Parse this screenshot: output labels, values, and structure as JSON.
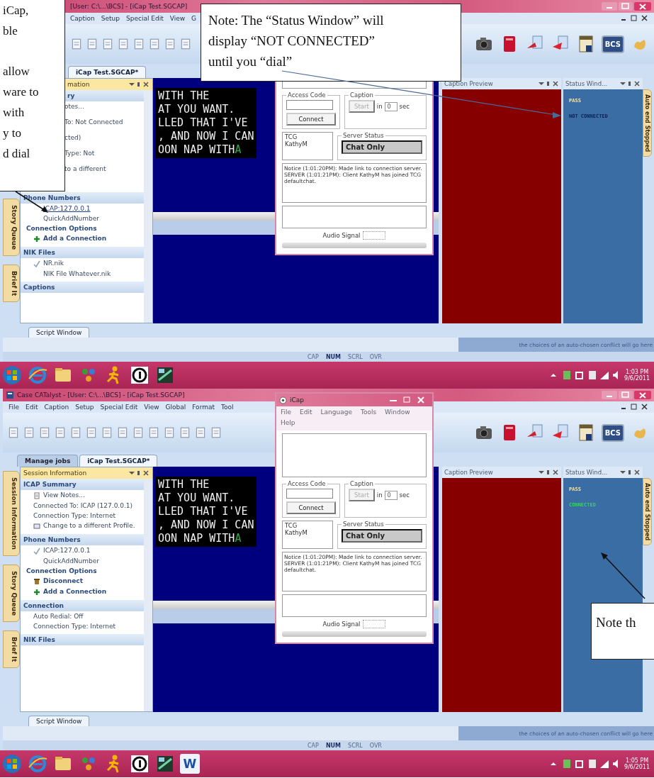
{
  "screens": [
    {
      "window": {
        "title": "[User: C:\\...\\BCS] - [iCap Test.SGCAP]"
      },
      "menu": [
        "Caption",
        "Setup",
        "Special Edit",
        "View",
        "G"
      ],
      "toolbar": {
        "label": "BCS"
      },
      "tabs": [
        {
          "label": "iCap Test.SGCAP*",
          "selected": true
        }
      ],
      "panel": {
        "title": "mation",
        "sections": [
          {
            "heading": "ry",
            "items": [
              {
                "kind": "text",
                "text": "otes..."
              },
              {
                "kind": "text",
                "text": "To: Not Connected"
              },
              {
                "kind": "text",
                "text": "cted)"
              },
              {
                "kind": "text",
                "text": "Type: Not"
              },
              {
                "kind": "text",
                "text": "to a different"
              }
            ]
          },
          {
            "heading": "Phone Numbers",
            "items": [
              {
                "kind": "link",
                "text": "ICAP:127.0.0.1"
              },
              {
                "kind": "indent",
                "text": "QuickAddNumber"
              },
              {
                "kind": "subhead",
                "text": "Connection Options"
              },
              {
                "kind": "add",
                "text": "Add a Connection"
              }
            ]
          },
          {
            "heading": "NIK Files",
            "items": [
              {
                "kind": "checked",
                "text": "NR.nik"
              },
              {
                "kind": "indent",
                "text": "NIK File Whatever.nik"
              }
            ]
          },
          {
            "heading": "Captions"
          }
        ]
      },
      "side_tabs": [
        "Story Queue",
        "Brief It"
      ],
      "editor_lines": [
        {
          "text": "WITH THE"
        },
        {
          "text": "AT YOU WANT."
        },
        {
          "text": "LLED THAT I'VE"
        },
        {
          "text": ", AND NOW I CAN"
        },
        {
          "text": "OON NAP WITH",
          "cursor": "A"
        }
      ],
      "caption_preview": {
        "title": "Caption Preview"
      },
      "status_window": {
        "title": "Status Wind...",
        "lines": [
          {
            "kind": "result",
            "text": "PASS"
          },
          {
            "kind": "connection",
            "text": "NOT CONNECTED",
            "connected": false
          }
        ]
      },
      "right_tab": "Auto end Stopped",
      "script_tab": "Script Window",
      "conflict_message": "the choices of an auto-chosen conflict will go here",
      "indicators": [
        {
          "label": "CAP",
          "on": false
        },
        {
          "label": "NUM",
          "on": true
        },
        {
          "label": "SCRL",
          "on": false
        },
        {
          "label": "OVR",
          "on": false
        }
      ],
      "dialog": {
        "access_code_label": "Access Code",
        "connect": "Connect",
        "caption_label": "Caption",
        "start": "Start",
        "start_disabled": true,
        "in": "in",
        "delay": "0",
        "sec": "sec",
        "users": [
          "TCG",
          "KathyM"
        ],
        "server_status_label": "Server Status",
        "server_status": "Chat Only",
        "log": [
          "Notice (1:01:20PM): Made link to connection server.",
          "SERVER (1:01:21PM): Client KathyM has joined TCG defaultchat."
        ],
        "audio_label": "Audio Signal"
      },
      "taskbar": {
        "apps": [
          {
            "kind": "start"
          },
          {
            "kind": "browser"
          },
          {
            "kind": "folder"
          },
          {
            "kind": "network"
          },
          {
            "kind": "runner"
          },
          {
            "kind": "info"
          },
          {
            "kind": "app"
          }
        ],
        "time": "1:03 PM",
        "date": "9/6/2011"
      },
      "callouts": [
        {
          "kind": "side",
          "lines": [
            "iCap,",
            "ble",
            "allow",
            "ware to",
            "with",
            "y to",
            "d dial"
          ]
        },
        {
          "kind": "box",
          "text": "Note: The “Status Window” will display “NOT CONNECTED” until you “dial”"
        }
      ]
    },
    {
      "window": {
        "title": "Case CATalyst - [User: C:\\...\\BCS] - [iCap Test.SGCAP]"
      },
      "menu": [
        "File",
        "Edit",
        "Caption",
        "Setup",
        "Special Edit",
        "View",
        "Global",
        "Format",
        "Tool"
      ],
      "toolbar": {
        "label": "BCS"
      },
      "tabs": [
        {
          "label": "Manage jobs",
          "selected": false
        },
        {
          "label": "iCap Test.SGCAP*",
          "selected": true
        }
      ],
      "panel": {
        "title": "Session Information",
        "sections": [
          {
            "heading": "ICAP Summary",
            "items": [
              {
                "kind": "notes",
                "text": "View Notes..."
              },
              {
                "kind": "text",
                "text": "Connected To: ICAP (127.0.0.1)"
              },
              {
                "kind": "text",
                "text": "Connection Type: Internet"
              },
              {
                "kind": "change",
                "text": "Change to a different Profile."
              }
            ]
          },
          {
            "heading": "Phone Numbers",
            "items": [
              {
                "kind": "checked",
                "text": "ICAP:127.0.0.1"
              },
              {
                "kind": "indent",
                "text": "QuickAddNumber"
              },
              {
                "kind": "subhead",
                "text": "Connection Options"
              },
              {
                "kind": "disconnect",
                "text": "Disconnect"
              },
              {
                "kind": "add",
                "text": "Add a Connection"
              }
            ]
          },
          {
            "heading": "Connection",
            "items": [
              {
                "kind": "text",
                "text": "Auto Redial: Off"
              },
              {
                "kind": "text",
                "text": "Connection Type: Internet"
              }
            ]
          },
          {
            "heading": "NIK Files"
          }
        ]
      },
      "side_tabs": [
        "Session Information",
        "Story Queue",
        "Brief It"
      ],
      "editor_lines": [
        {
          "text": "WITH THE"
        },
        {
          "text": "AT YOU WANT."
        },
        {
          "text": "LLED THAT I'VE"
        },
        {
          "text": ", AND NOW I CAN"
        },
        {
          "text": "OON NAP WITH",
          "cursor": "A"
        }
      ],
      "caption_preview": {
        "title": "Caption Preview"
      },
      "status_window": {
        "title": "Status Wind...",
        "lines": [
          {
            "kind": "result",
            "text": "PASS"
          },
          {
            "kind": "connection",
            "text": "CONNECTED",
            "connected": true
          }
        ]
      },
      "right_tab": "Auto end Stopped",
      "script_tab": "Script Window",
      "conflict_message": "the choices of an auto-chosen conflict will go here",
      "indicators": [
        {
          "label": "CAP",
          "on": false
        },
        {
          "label": "NUM",
          "on": true
        },
        {
          "label": "SCRL",
          "on": false
        },
        {
          "label": "OVR",
          "on": false
        }
      ],
      "dialog": {
        "title": "iCap",
        "menu": [
          "File",
          "Edit",
          "Language",
          "Tools",
          "Window",
          "Help"
        ],
        "access_code_label": "Access Code",
        "connect": "Connect",
        "caption_label": "Caption",
        "start": "Start",
        "start_disabled": true,
        "in": "in",
        "delay": "0",
        "sec": "sec",
        "users": [
          "TCG",
          "KathyM"
        ],
        "server_status_label": "Server Status",
        "server_status": "Chat Only",
        "log": [
          "Notice (1:01:20PM): Made link to connection server.",
          "SERVER (1:01:21PM): Client KathyM has joined TCG defaultchat."
        ],
        "audio_label": "Audio Signal"
      },
      "taskbar": {
        "apps": [
          {
            "kind": "start"
          },
          {
            "kind": "browser"
          },
          {
            "kind": "folder"
          },
          {
            "kind": "network"
          },
          {
            "kind": "runner"
          },
          {
            "kind": "info"
          },
          {
            "kind": "app"
          },
          {
            "kind": "word",
            "label": "W"
          }
        ],
        "time": "1:05 PM",
        "date": "9/6/2011"
      },
      "callouts": [
        {
          "kind": "corner",
          "text": "Note th"
        }
      ]
    }
  ]
}
